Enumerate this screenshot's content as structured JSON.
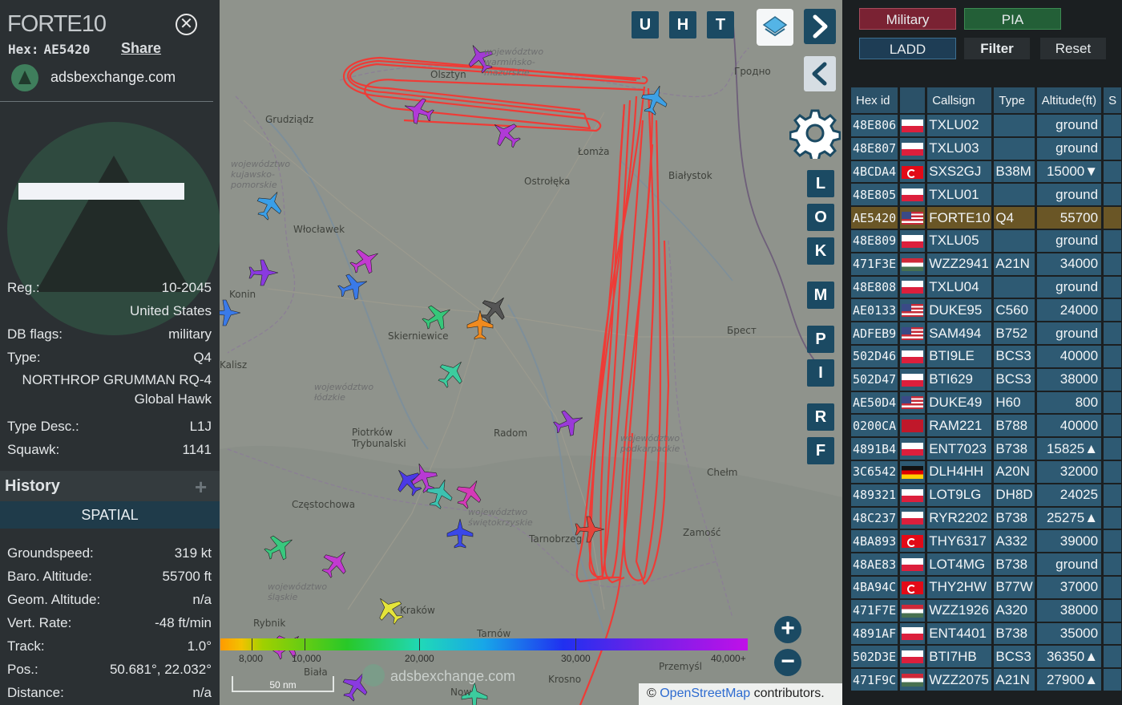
{
  "info_panel": {
    "callsign": "FORTE10",
    "hex_label": "Hex:",
    "hex_value": "AE5420",
    "share_label": "Share",
    "source_site": "adsbexchange.com",
    "details": [
      {
        "key": "Reg.:",
        "value": "10-2045"
      },
      {
        "key": "",
        "value": "United States"
      },
      {
        "key": "DB flags:",
        "value": "military"
      },
      {
        "key": "Type:",
        "value": "Q4"
      }
    ],
    "type_long_line1": "NORTHROP GRUMMAN RQ-4",
    "type_long_line2": "Global Hawk",
    "details2": [
      {
        "key": "Type Desc.:",
        "value": "L1J"
      },
      {
        "key": "Squawk:",
        "value": "1141"
      }
    ],
    "history_label": "History",
    "spatial_label": "SPATIAL",
    "spatial": [
      {
        "key": "Groundspeed:",
        "value": "319 kt"
      },
      {
        "key": "Baro. Altitude:",
        "value": "55700 ft"
      },
      {
        "key": "Geom. Altitude:",
        "value": "n/a"
      },
      {
        "key": "Vert. Rate:",
        "value": "-48 ft/min"
      },
      {
        "key": "Track:",
        "value": "1.0°"
      },
      {
        "key": "Pos.:",
        "value": "50.681°, 22.032°"
      },
      {
        "key": "Distance:",
        "value": "n/a"
      }
    ]
  },
  "map": {
    "top_buttons": [
      "U",
      "H",
      "T"
    ],
    "side_buttons": [
      "L",
      "O",
      "K",
      "M",
      "P",
      "I",
      "R",
      "F"
    ],
    "zoom_in": "+",
    "zoom_out": "−",
    "scale_label": "50 nm",
    "watermark": "adsbexchange.com",
    "attribution_prefix": "© ",
    "attribution_link": "OpenStreetMap",
    "attribution_suffix": " contributors.",
    "altitude_ticks": [
      "8,000",
      "10,000",
      "20,000",
      "30,000",
      "40,000+"
    ],
    "labels": {
      "olsztyn": "Olsztyn",
      "wojewodztwo_wm": "województwo warmińsko-mazurskie",
      "grodno": "Гродно",
      "grudziadz": "Grudziądz",
      "lomza": "Łomża",
      "bialystok": "Białystok",
      "ostroleka": "Ostrołęka",
      "woj_kp": "województwo kujawsko-pomorskie",
      "wloclawek": "Włocławek",
      "konin": "Konin",
      "skierniewice": "Skierniewice",
      "brest": "Брест",
      "woj_lodzkie": "województwo łódzkie",
      "piotrkow": "Piotrków Trybunalski",
      "radom": "Radom",
      "chelm": "Chełm",
      "czestochowa": "Częstochowa",
      "woj_sw": "województwo świętokrzyskie",
      "tarnobrzeg": "Tarnobrzeg",
      "zamosc": "Zamość",
      "woj_slaskie": "województwo śląskie",
      "rybnik": "Rybnik",
      "krakow": "Kraków",
      "tarnow": "Tarnów",
      "przemysl": "Przemyśl",
      "krosno": "Krosno",
      "woj_podkarpackie": "województwo podkarpackie",
      "kalisz": "Kalisz",
      "bialla": "Biała",
      "nowy": "Now"
    }
  },
  "table_panel": {
    "buttons": {
      "military": "Military",
      "pia": "PIA",
      "ladd": "LADD",
      "filter": "Filter",
      "reset": "Reset"
    },
    "columns": [
      "Hex id",
      "",
      "Callsign",
      "Type",
      "Altitude(ft)",
      "S"
    ],
    "rows": [
      {
        "hex": "48E806",
        "flag": "pl",
        "callsign": "TXLU02",
        "type": "",
        "alt": "ground"
      },
      {
        "hex": "48E807",
        "flag": "pl",
        "callsign": "TXLU03",
        "type": "",
        "alt": "ground"
      },
      {
        "hex": "4BCDA4",
        "flag": "tr",
        "callsign": "SXS2GJ",
        "type": "B38M",
        "alt": "15000▼"
      },
      {
        "hex": "48E805",
        "flag": "pl",
        "callsign": "TXLU01",
        "type": "",
        "alt": "ground"
      },
      {
        "hex": "AE5420",
        "flag": "us",
        "callsign": "FORTE10",
        "type": "Q4",
        "alt": "55700",
        "selected": true
      },
      {
        "hex": "48E809",
        "flag": "pl",
        "callsign": "TXLU05",
        "type": "",
        "alt": "ground"
      },
      {
        "hex": "471F3E",
        "flag": "hu",
        "callsign": "WZZ2941",
        "type": "A21N",
        "alt": "34000"
      },
      {
        "hex": "48E808",
        "flag": "pl",
        "callsign": "TXLU04",
        "type": "",
        "alt": "ground"
      },
      {
        "hex": "AE0133",
        "flag": "us",
        "callsign": "DUKE95",
        "type": "C560",
        "alt": "24000"
      },
      {
        "hex": "ADFEB9",
        "flag": "us",
        "callsign": "SAM494",
        "type": "B752",
        "alt": "ground"
      },
      {
        "hex": "502D46",
        "flag": "pl",
        "callsign": "BTI9LE",
        "type": "BCS3",
        "alt": "40000"
      },
      {
        "hex": "502D47",
        "flag": "pl",
        "callsign": "BTI629",
        "type": "BCS3",
        "alt": "38000"
      },
      {
        "hex": "AE50D4",
        "flag": "us",
        "callsign": "DUKE49",
        "type": "H60",
        "alt": "800"
      },
      {
        "hex": "0200CA",
        "flag": "ma",
        "callsign": "RAM221",
        "type": "B788",
        "alt": "40000"
      },
      {
        "hex": "4891B4",
        "flag": "pl",
        "callsign": "ENT7023",
        "type": "B738",
        "alt": "15825▲"
      },
      {
        "hex": "3C6542",
        "flag": "de",
        "callsign": "DLH4HH",
        "type": "A20N",
        "alt": "32000"
      },
      {
        "hex": "489321",
        "flag": "pl",
        "callsign": "LOT9LG",
        "type": "DH8D",
        "alt": "24025"
      },
      {
        "hex": "48C237",
        "flag": "pl",
        "callsign": "RYR2202",
        "type": "B738",
        "alt": "25275▲"
      },
      {
        "hex": "4BA893",
        "flag": "tr",
        "callsign": "THY6317",
        "type": "A332",
        "alt": "39000"
      },
      {
        "hex": "48AE83",
        "flag": "pl",
        "callsign": "LOT4MG",
        "type": "B738",
        "alt": "ground"
      },
      {
        "hex": "4BA94C",
        "flag": "tr",
        "callsign": "THY2HW",
        "type": "B77W",
        "alt": "37000"
      },
      {
        "hex": "471F7E",
        "flag": "hu",
        "callsign": "WZZ1926",
        "type": "A320",
        "alt": "38000"
      },
      {
        "hex": "4891AF",
        "flag": "pl",
        "callsign": "ENT4401",
        "type": "B738",
        "alt": "35000"
      },
      {
        "hex": "502D3E",
        "flag": "pl",
        "callsign": "BTI7HB",
        "type": "BCS3",
        "alt": "36350▲"
      },
      {
        "hex": "471F9C",
        "flag": "hu",
        "callsign": "WZZ2075",
        "type": "A21N",
        "alt": "27900▲"
      }
    ]
  },
  "colors": {
    "track": "#ef3b36",
    "selected_row": "#6a5626",
    "row": "#2e5a73",
    "header": "#2b5168"
  }
}
